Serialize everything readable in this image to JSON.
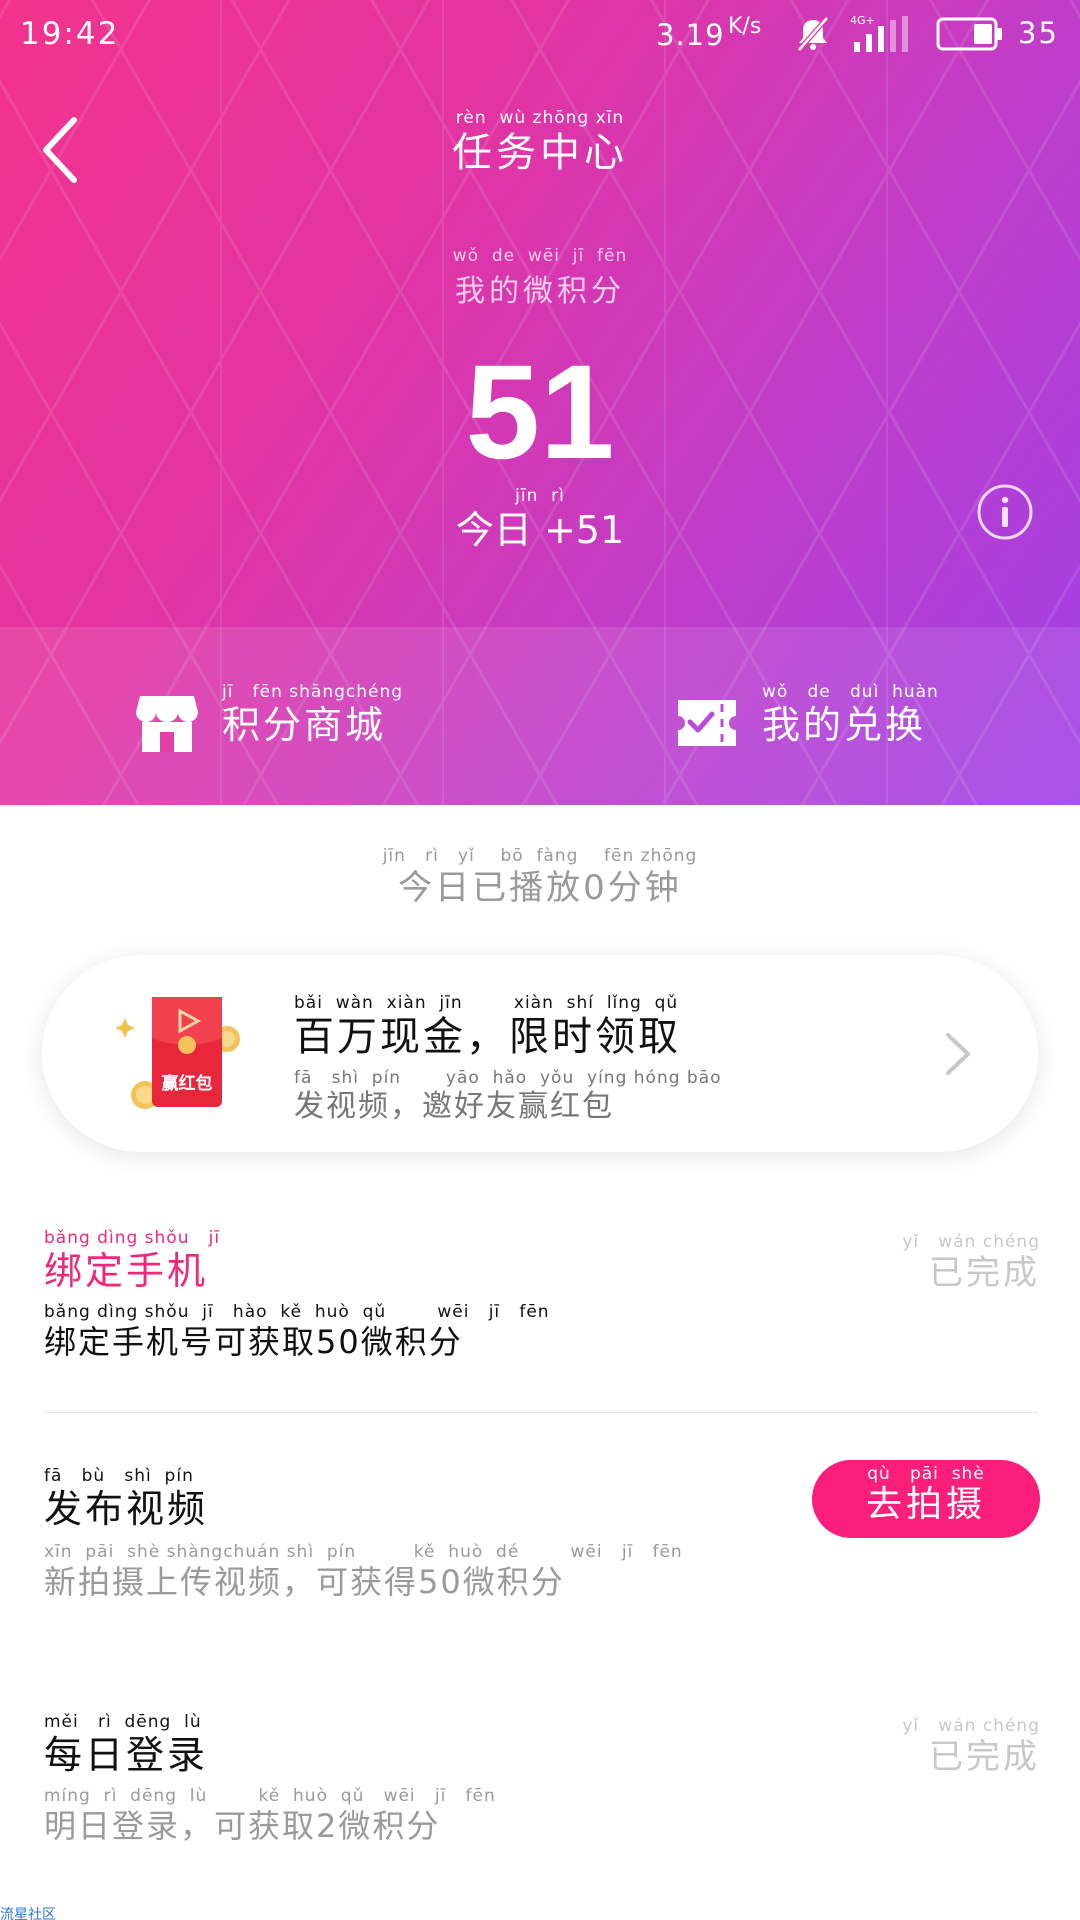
{
  "status_bar": {
    "time": "19:42",
    "net_speed": "3.19",
    "net_speed_unit": "K/s",
    "signal_label": "4G+",
    "battery": "35"
  },
  "header": {
    "title_pinyin": "rèn  wù zhōng xīn",
    "title": "任务中心"
  },
  "points": {
    "label_pinyin": "wǒ  de  wēi  jī  fēn",
    "label": "我的微积分",
    "value": "51",
    "today_pinyin": "jīn  rì",
    "today": "今日 +51"
  },
  "strip": {
    "shop_pinyin": "jī   fēn shāngchéng",
    "shop_label": "积分商城",
    "exchange_pinyin": "wǒ   de   duì  huàn",
    "exchange_label": "我的兑换"
  },
  "played": {
    "pinyin": "jīn   rì   yǐ    bō  fàng    fēn zhōng",
    "text": "今日已播放0分钟"
  },
  "promo": {
    "title_pinyin": "bǎi  wàn  xiàn  jīn        xiàn  shí  lǐng  qǔ",
    "title": "百万现金，限时领取",
    "sub_pinyin": "fā   shì  pín       yāo  hǎo  yǒu  yíng hóng bāo",
    "subtitle": "发视频，邀好友赢红包",
    "badge": "赢红包"
  },
  "tasks": [
    {
      "name_pinyin": "bǎng dìng shǒu   jī",
      "name": "绑定手机",
      "name_color": "#f0287a",
      "desc_pinyin": "bǎng dìng shǒu  jī   hào  kě  huò  qǔ        wēi   jī   fēn",
      "desc": "绑定手机号可获取50微积分",
      "desc_color": "#111111",
      "status_pinyin": "yǐ   wán chéng",
      "status": "已完成"
    },
    {
      "name_pinyin": "fā   bù   shì  pín",
      "name": "发布视频",
      "name_color": "#111111",
      "desc_pinyin": "xīn  pāi  shè shàngchuán shì  pín         kě  huò  dé        wēi   jī   fēn",
      "desc": "新拍摄上传视频，可获得50微积分",
      "desc_color": "#9a9a9a",
      "button_pinyin": "qù   pāi  shè",
      "button": "去拍摄"
    },
    {
      "name_pinyin": "měi   rì  dēng  lù",
      "name": "每日登录",
      "name_color": "#111111",
      "desc_pinyin": "míng  rì  dēng  lù        kě  huò  qǔ   wēi   jī   fēn",
      "desc": "明日登录，可获取2微积分",
      "desc_color": "#9a9a9a",
      "status_pinyin": "yǐ   wán chéng",
      "status": "已完成"
    }
  ],
  "watermark": "流星社区",
  "colors": {
    "accent": "#fb1f7b",
    "gradient_start": "#f2338c",
    "gradient_end": "#9f40e6"
  },
  "icons": [
    "back-arrow-icon",
    "mute-bell-icon",
    "signal-icon",
    "battery-icon",
    "info-icon",
    "store-icon",
    "ticket-icon",
    "red-envelope-icon",
    "chevron-right-icon"
  ]
}
